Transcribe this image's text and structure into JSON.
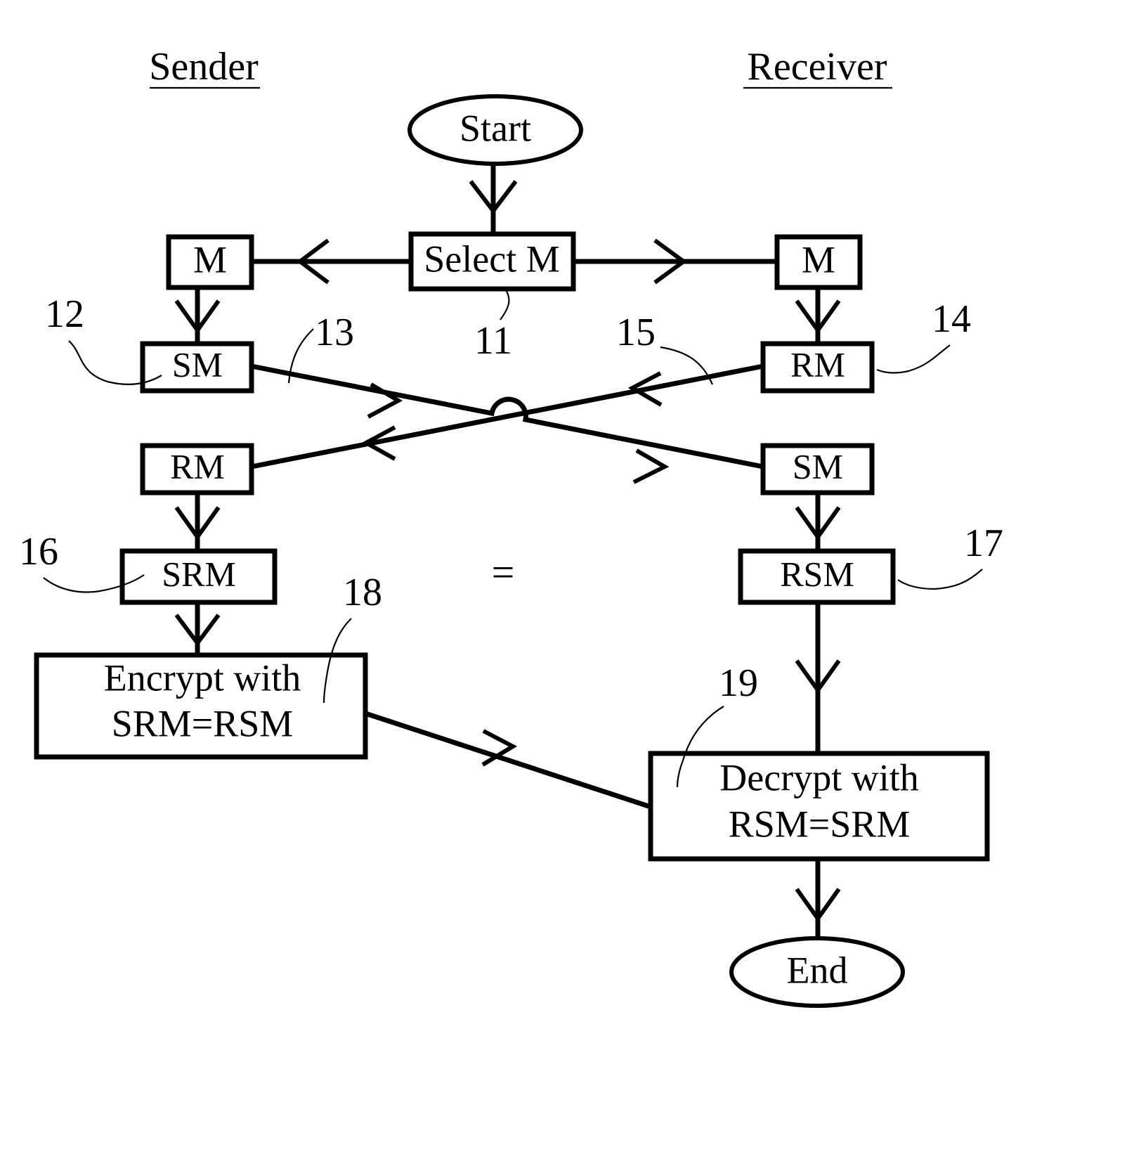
{
  "figure": {
    "type": "flowchart",
    "description": "Patent-style flow diagram showing symmetric key exchange between a Sender and a Receiver",
    "columns": [
      {
        "id": "sender",
        "label": "Sender"
      },
      {
        "id": "receiver",
        "label": "Receiver"
      }
    ],
    "nodes": {
      "start": {
        "label": "Start",
        "shape": "ellipse"
      },
      "select_m": {
        "label": "Select M",
        "shape": "rect"
      },
      "sender_m": {
        "label": "M",
        "shape": "rect"
      },
      "receiver_m": {
        "label": "M",
        "shape": "rect"
      },
      "sender_sm": {
        "label": "SM",
        "shape": "rect"
      },
      "receiver_rm": {
        "label": "RM",
        "shape": "rect"
      },
      "sender_rm": {
        "label": "RM",
        "shape": "rect"
      },
      "receiver_sm": {
        "label": "SM",
        "shape": "rect"
      },
      "sender_srm": {
        "label": "SRM",
        "shape": "rect"
      },
      "receiver_rsm": {
        "label": "RSM",
        "shape": "rect"
      },
      "encrypt": {
        "line1": "Encrypt with",
        "line2": "SRM=RSM",
        "shape": "rect"
      },
      "decrypt": {
        "line1": "Decrypt with",
        "line2": "RSM=SRM",
        "shape": "rect"
      },
      "end": {
        "label": "End",
        "shape": "ellipse"
      }
    },
    "equality_marker": "=",
    "reference_numerals": [
      {
        "id": "ref-11",
        "value": "11",
        "points_to": "select_m"
      },
      {
        "id": "ref-12",
        "value": "12",
        "points_to": "sender_sm"
      },
      {
        "id": "ref-13",
        "value": "13",
        "points_to": "sm-transmit-line"
      },
      {
        "id": "ref-14",
        "value": "14",
        "points_to": "receiver_rm"
      },
      {
        "id": "ref-15",
        "value": "15",
        "points_to": "rm-transmit-line"
      },
      {
        "id": "ref-16",
        "value": "16",
        "points_to": "sender_srm"
      },
      {
        "id": "ref-17",
        "value": "17",
        "points_to": "receiver_rsm"
      },
      {
        "id": "ref-18",
        "value": "18",
        "points_to": "encrypt"
      },
      {
        "id": "ref-19",
        "value": "19",
        "points_to": "decrypt"
      }
    ],
    "colors": {
      "stroke": "#000000",
      "background": "#ffffff",
      "text": "#000000"
    }
  }
}
